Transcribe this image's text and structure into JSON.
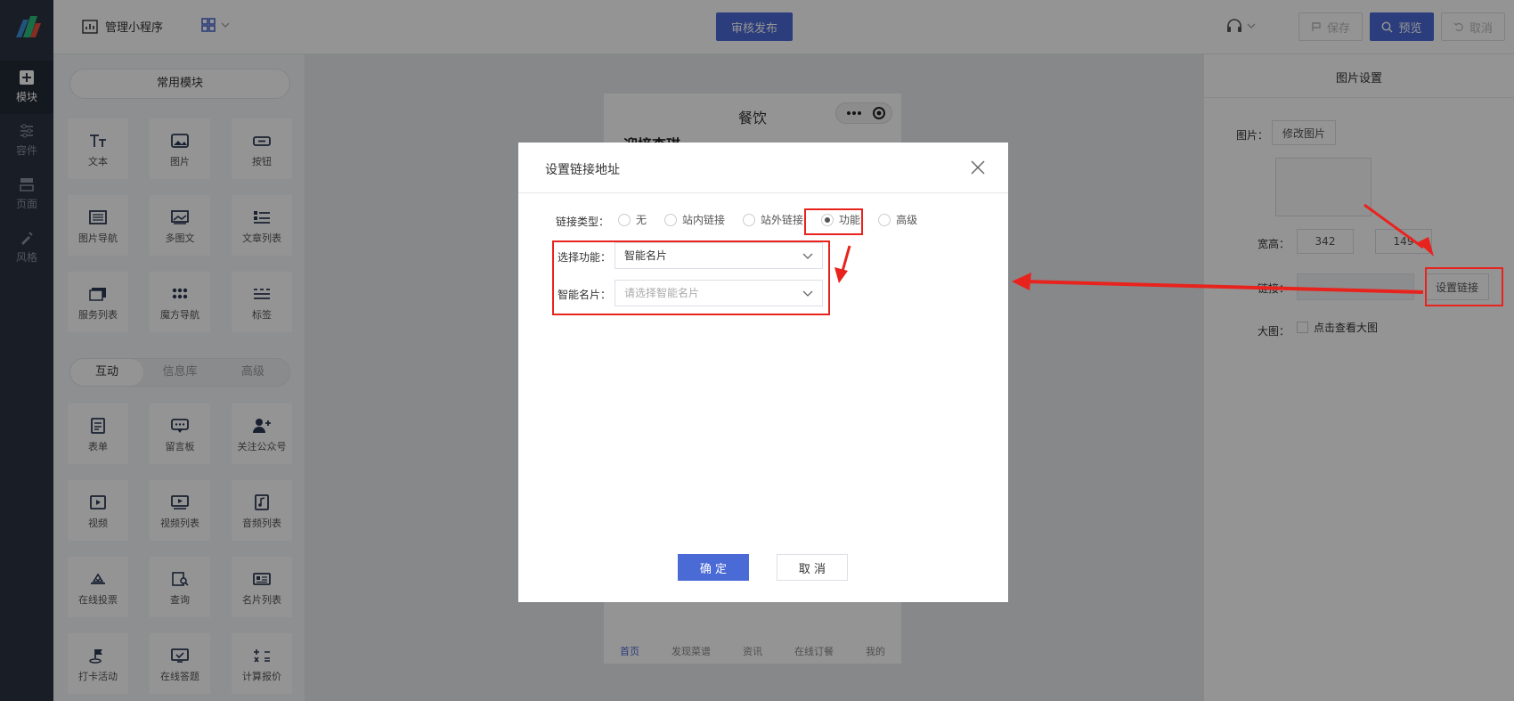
{
  "rail": {
    "items": [
      {
        "label": "模块",
        "icon": "plus-square-icon",
        "active": true
      },
      {
        "label": "容件",
        "icon": "sliders-icon",
        "active": false
      },
      {
        "label": "页面",
        "icon": "pages-icon",
        "active": false
      },
      {
        "label": "风格",
        "icon": "brush-icon",
        "active": false
      }
    ]
  },
  "topbar": {
    "app_title": "管理小程序",
    "publish_label": "审核发布",
    "save_label": "保存",
    "preview_label": "预览",
    "cancel_label": "取消"
  },
  "modules": {
    "common_header": "常用模块",
    "common": [
      {
        "label": "文本",
        "icon": "text-icon"
      },
      {
        "label": "图片",
        "icon": "image-icon"
      },
      {
        "label": "按钮",
        "icon": "button-icon"
      },
      {
        "label": "图片导航",
        "icon": "gallery-icon"
      },
      {
        "label": "多图文",
        "icon": "multi-image-icon"
      },
      {
        "label": "文章列表",
        "icon": "article-list-icon"
      },
      {
        "label": "服务列表",
        "icon": "service-list-icon"
      },
      {
        "label": "魔方导航",
        "icon": "dots-grid-icon"
      },
      {
        "label": "标签",
        "icon": "tag-icon"
      }
    ],
    "tabs": [
      "互动",
      "信息库",
      "高级"
    ],
    "interactive": [
      {
        "label": "表单",
        "icon": "form-icon"
      },
      {
        "label": "留言板",
        "icon": "message-board-icon"
      },
      {
        "label": "关注公众号",
        "icon": "follow-icon"
      },
      {
        "label": "视频",
        "icon": "video-icon"
      },
      {
        "label": "视频列表",
        "icon": "video-list-icon"
      },
      {
        "label": "音频列表",
        "icon": "audio-list-icon"
      },
      {
        "label": "在线投票",
        "icon": "vote-icon"
      },
      {
        "label": "查询",
        "icon": "search-doc-icon"
      },
      {
        "label": "名片列表",
        "icon": "card-list-icon"
      },
      {
        "label": "打卡活动",
        "icon": "checkin-icon"
      },
      {
        "label": "在线答题",
        "icon": "quiz-icon"
      },
      {
        "label": "计算报价",
        "icon": "calculator-icon"
      }
    ]
  },
  "phone": {
    "title": "餐饮",
    "subtitle": "迎接李琪",
    "nav": [
      "首页",
      "发现菜谱",
      "资讯",
      "在线订餐",
      "我的"
    ]
  },
  "right_panel": {
    "title": "图片设置",
    "image_label": "图片：",
    "change_image": "修改图片",
    "size_label": "宽高：",
    "width": "342",
    "height": "149",
    "link_label": "链接：",
    "set_link": "设置链接",
    "bigimg_label": "大图：",
    "bigimg_option": "点击查看大图"
  },
  "dialog": {
    "title": "设置链接地址",
    "link_type_label": "链接类型：",
    "link_types": [
      "无",
      "站内链接",
      "站外链接",
      "功能",
      "高级"
    ],
    "selected_type": "功能",
    "func_label": "选择功能：",
    "func_value": "智能名片",
    "card_label": "智能名片：",
    "card_placeholder": "请选择智能名片",
    "ok_label": "确 定",
    "cancel_label": "取 消"
  },
  "colors": {
    "accent": "#4a6ad6",
    "annotation": "#e8231e",
    "rail_bg": "#2b3240"
  }
}
